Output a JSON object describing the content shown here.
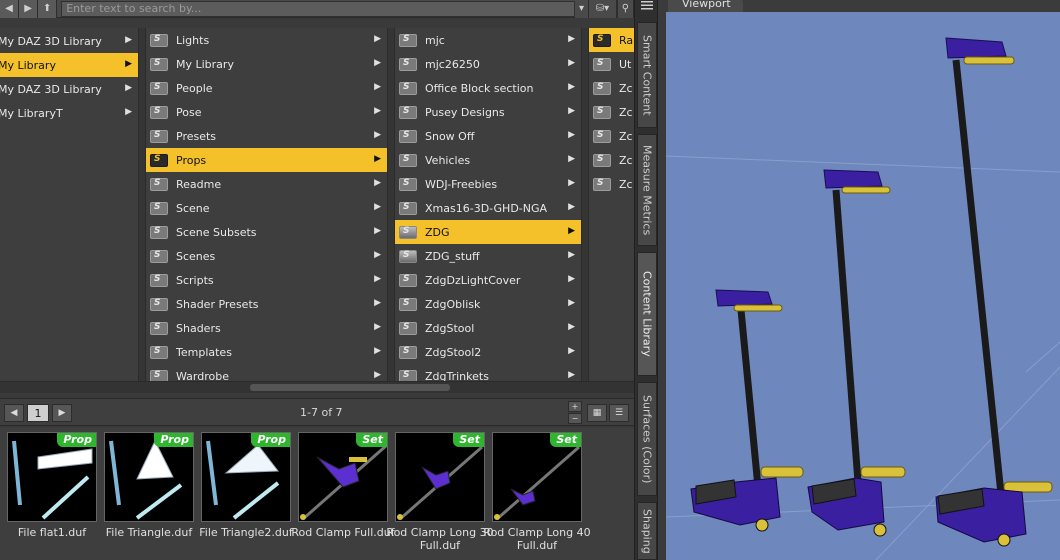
{
  "toolbar": {
    "back_icon": "arrow-left-icon",
    "forward_icon": "arrow-right-icon",
    "up_icon": "arrow-up-icon",
    "search_placeholder": "Enter text to search by...",
    "database_icon": "database-icon"
  },
  "columns": [
    {
      "items": [
        {
          "label": "My DAZ 3D Library",
          "selected": false,
          "has_children": true
        },
        {
          "label": "My Library",
          "selected": true,
          "has_children": true
        },
        {
          "label": "My DAZ 3D Library",
          "selected": false,
          "has_children": true
        },
        {
          "label": "My LibraryT",
          "selected": false,
          "has_children": true
        }
      ]
    },
    {
      "items": [
        {
          "label": "Lights"
        },
        {
          "label": "My Library"
        },
        {
          "label": "People"
        },
        {
          "label": "Pose"
        },
        {
          "label": "Presets"
        },
        {
          "label": "Props",
          "selected": true
        },
        {
          "label": "Readme"
        },
        {
          "label": "Scene"
        },
        {
          "label": "Scene Subsets"
        },
        {
          "label": "Scenes"
        },
        {
          "label": "Scripts"
        },
        {
          "label": "Shader Presets"
        },
        {
          "label": "Shaders"
        },
        {
          "label": "Templates"
        },
        {
          "label": "Wardrobe"
        }
      ]
    },
    {
      "items": [
        {
          "label": "mjc"
        },
        {
          "label": "mjc26250"
        },
        {
          "label": "Office Block section"
        },
        {
          "label": "Pusey Designs"
        },
        {
          "label": "Snow Off"
        },
        {
          "label": "Vehicles"
        },
        {
          "label": "WDJ-Freebies"
        },
        {
          "label": "Xmas16-3D-GHD-NGA"
        },
        {
          "label": "ZDG",
          "selected": true
        },
        {
          "label": "ZDG_stuff"
        },
        {
          "label": "ZdgDzLightCover"
        },
        {
          "label": "ZdgOblisk"
        },
        {
          "label": "ZdgStool"
        },
        {
          "label": "ZdgStool2"
        },
        {
          "label": "ZdgTrinkets"
        }
      ]
    },
    {
      "items": [
        {
          "label": "Ra",
          "selected": true
        },
        {
          "label": "Ut"
        },
        {
          "label": "Zc"
        },
        {
          "label": "Zc"
        },
        {
          "label": "Zc"
        },
        {
          "label": "Zc"
        },
        {
          "label": "Zc"
        }
      ]
    }
  ],
  "pager": {
    "prev_icon": "arrow-left-icon",
    "page": "1",
    "next_icon": "arrow-right-icon",
    "count": "1-7 of 7",
    "grid_view_icon": "grid-view-icon",
    "list_view_icon": "list-view-icon"
  },
  "thumbnails": [
    {
      "label": "File flat1.duf",
      "badge": "Prop"
    },
    {
      "label": "File Triangle.duf",
      "badge": "Prop"
    },
    {
      "label": "File Triangle2.duf",
      "badge": "Prop"
    },
    {
      "label": "Rod Clamp Full.duf",
      "badge": "Set"
    },
    {
      "label": "Rod Clamp Long 30 Full.duf",
      "badge": "Set"
    },
    {
      "label": "Rod Clamp Long 40 Full.duf",
      "badge": "Set"
    }
  ],
  "side_tabs": [
    {
      "label": "Smart Content"
    },
    {
      "label": "Measure Metrics"
    },
    {
      "label": "Content Library",
      "active": true
    },
    {
      "label": "Surfaces (Color)"
    },
    {
      "label": "Shaping"
    }
  ],
  "viewport": {
    "title": "Viewport",
    "background_color": "#6e87bd"
  },
  "colors": {
    "selection": "#f5c12b",
    "prop_badge": "#2fb52f"
  }
}
